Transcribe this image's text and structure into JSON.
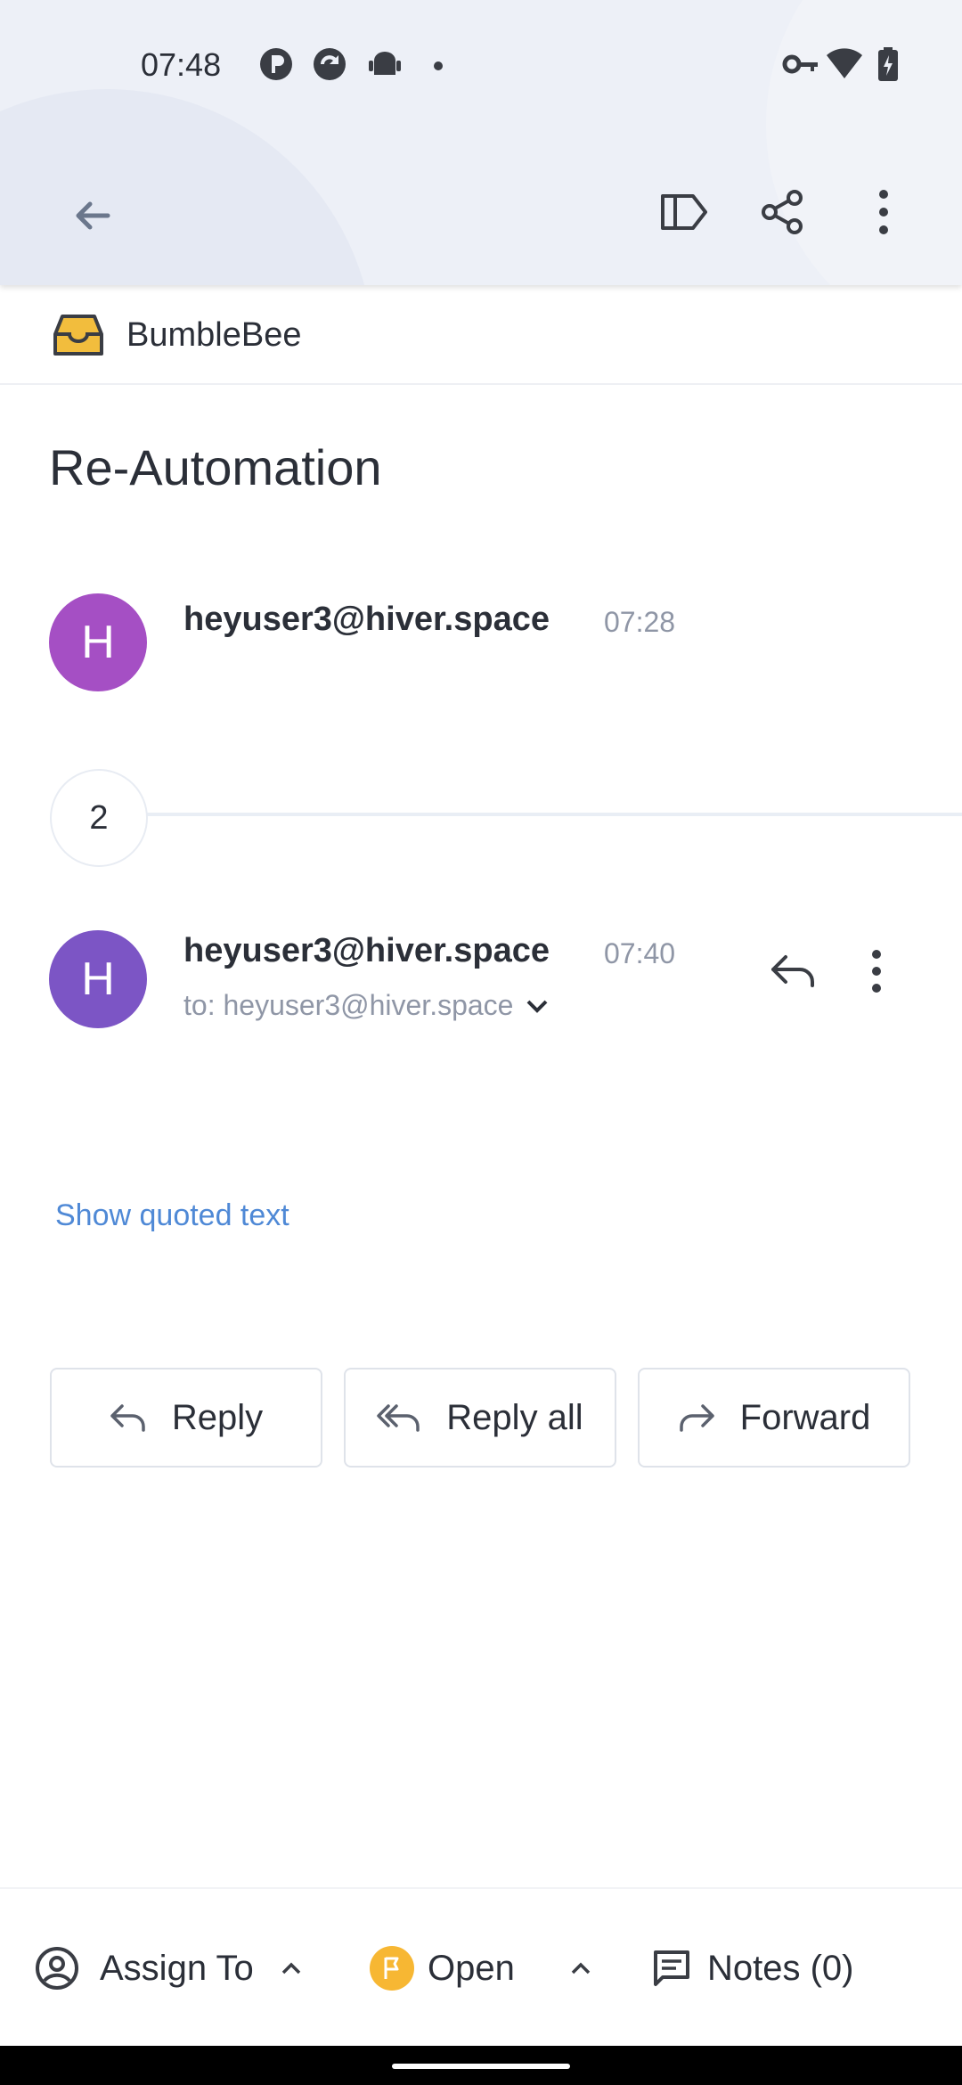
{
  "status_bar": {
    "time": "07:48",
    "left_icons": [
      "p-icon",
      "sync-icon",
      "android-icon",
      "dot-icon"
    ],
    "right_icons": [
      "key-icon",
      "wifi-icon",
      "battery-charging-icon"
    ]
  },
  "toolbar": {
    "icons": [
      "back-arrow-icon",
      "label-icon",
      "share-icon",
      "more-vert-icon"
    ]
  },
  "inbox": {
    "name": "BumbleBee",
    "icon": "inbox-tray-icon",
    "icon_color": "#f2bd3d"
  },
  "subject": "Re-Automation",
  "messages": [
    {
      "avatar_letter": "H",
      "avatar_color": "#a54fc4",
      "sender": "heyuser3@hiver.space",
      "time": "07:28"
    },
    {
      "avatar_letter": "H",
      "avatar_color": "#7c55c5",
      "sender": "heyuser3@hiver.space",
      "time": "07:40",
      "to": "to: heyuser3@hiver.space"
    }
  ],
  "collapsed_count": "2",
  "show_quoted_text": "Show quoted text",
  "actions": {
    "reply": "Reply",
    "reply_all": "Reply all",
    "forward": "Forward"
  },
  "bottom_bar": {
    "assign_label": "Assign To",
    "status_label": "Open",
    "status_color": "#f7b733",
    "notes_label": "Notes (0)"
  },
  "colors": {
    "link": "#4f89d6",
    "text": "#2b2f38",
    "muted": "#8f96a6",
    "header_bg": "#edf0f7"
  }
}
